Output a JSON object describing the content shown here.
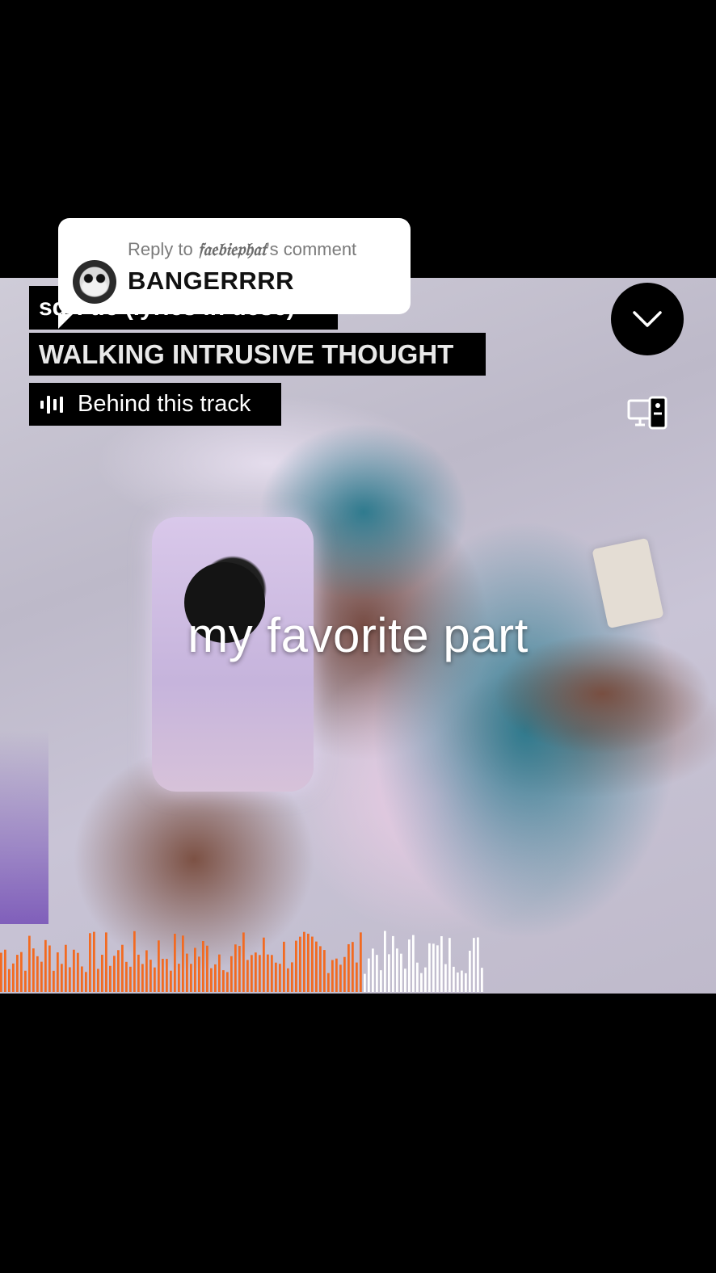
{
  "reply_card": {
    "prefix": "Reply to",
    "username": "𝔣𝔞𝔢𝔟𝔦𝔢𝔭𝔥𝔞𝔱",
    "suffix": "'s comment",
    "comment": "BANGERRRR"
  },
  "track": {
    "artist": "sqrl tic (lyrics in desc)",
    "title": "WALKING INTRUSIVE THOUGHT",
    "behind_label": "Behind this track"
  },
  "video": {
    "caption": "my favorite part"
  },
  "waveform": {
    "played_color": "#f26a21",
    "unplayed_color": "#ffffff",
    "progress": 0.75,
    "bar_count": 120
  },
  "icons": {
    "collapse": "chevron-down-icon",
    "cast": "device-cast-icon",
    "sound": "soundwave-icon"
  }
}
